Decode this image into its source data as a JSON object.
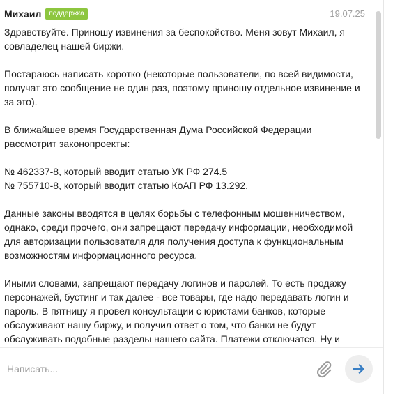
{
  "message": {
    "author": "Михаил",
    "badge": "поддержка",
    "timestamp": "19.07.25",
    "paragraphs": [
      "Здравствуйте. Приношу извинения за беспокойство. Меня зовут Михаил, я совладелец нашей биржи.",
      "Постараюсь написать коротко (некоторые пользователи, по всей видимости, получат это сообщение не один раз, поэтому приношу отдельное извинение и за это).",
      "В ближайшее время Государственная Дума Российской Федерации рассмотрит законопроекты:",
      "№ 462337-8, который вводит статью УК РФ 274.5",
      "№ 755710-8, который вводит статью КоАП РФ 13.292.",
      "Данные законы вводятся в целях борьбы с телефонным мошенничеством, однако, среди прочего, они запрещают передачу информации, необходимой для авторизации пользователя для получения доступа к функциональным возможностям информационного ресурса.",
      "Иными словами, запрещают передачу логинов и паролей. То есть продажу персонажей, бустинг и так далее - все товары, где надо передавать логин и пароль. В пятницу я провел консультации с юристами банков, которые обслуживают нашу биржу, и получил ответ о том, что банки не будут обслуживать подобные разделы нашего сайта. Платежи отключатся. Ну и"
    ]
  },
  "composer": {
    "placeholder": "Написать...",
    "attach_icon": "paperclip-icon",
    "send_icon": "arrow-right-icon"
  },
  "colors": {
    "badge": "#8dc63f",
    "send_arrow": "#3a7fc4",
    "icon_gray": "#9a9a9a"
  }
}
